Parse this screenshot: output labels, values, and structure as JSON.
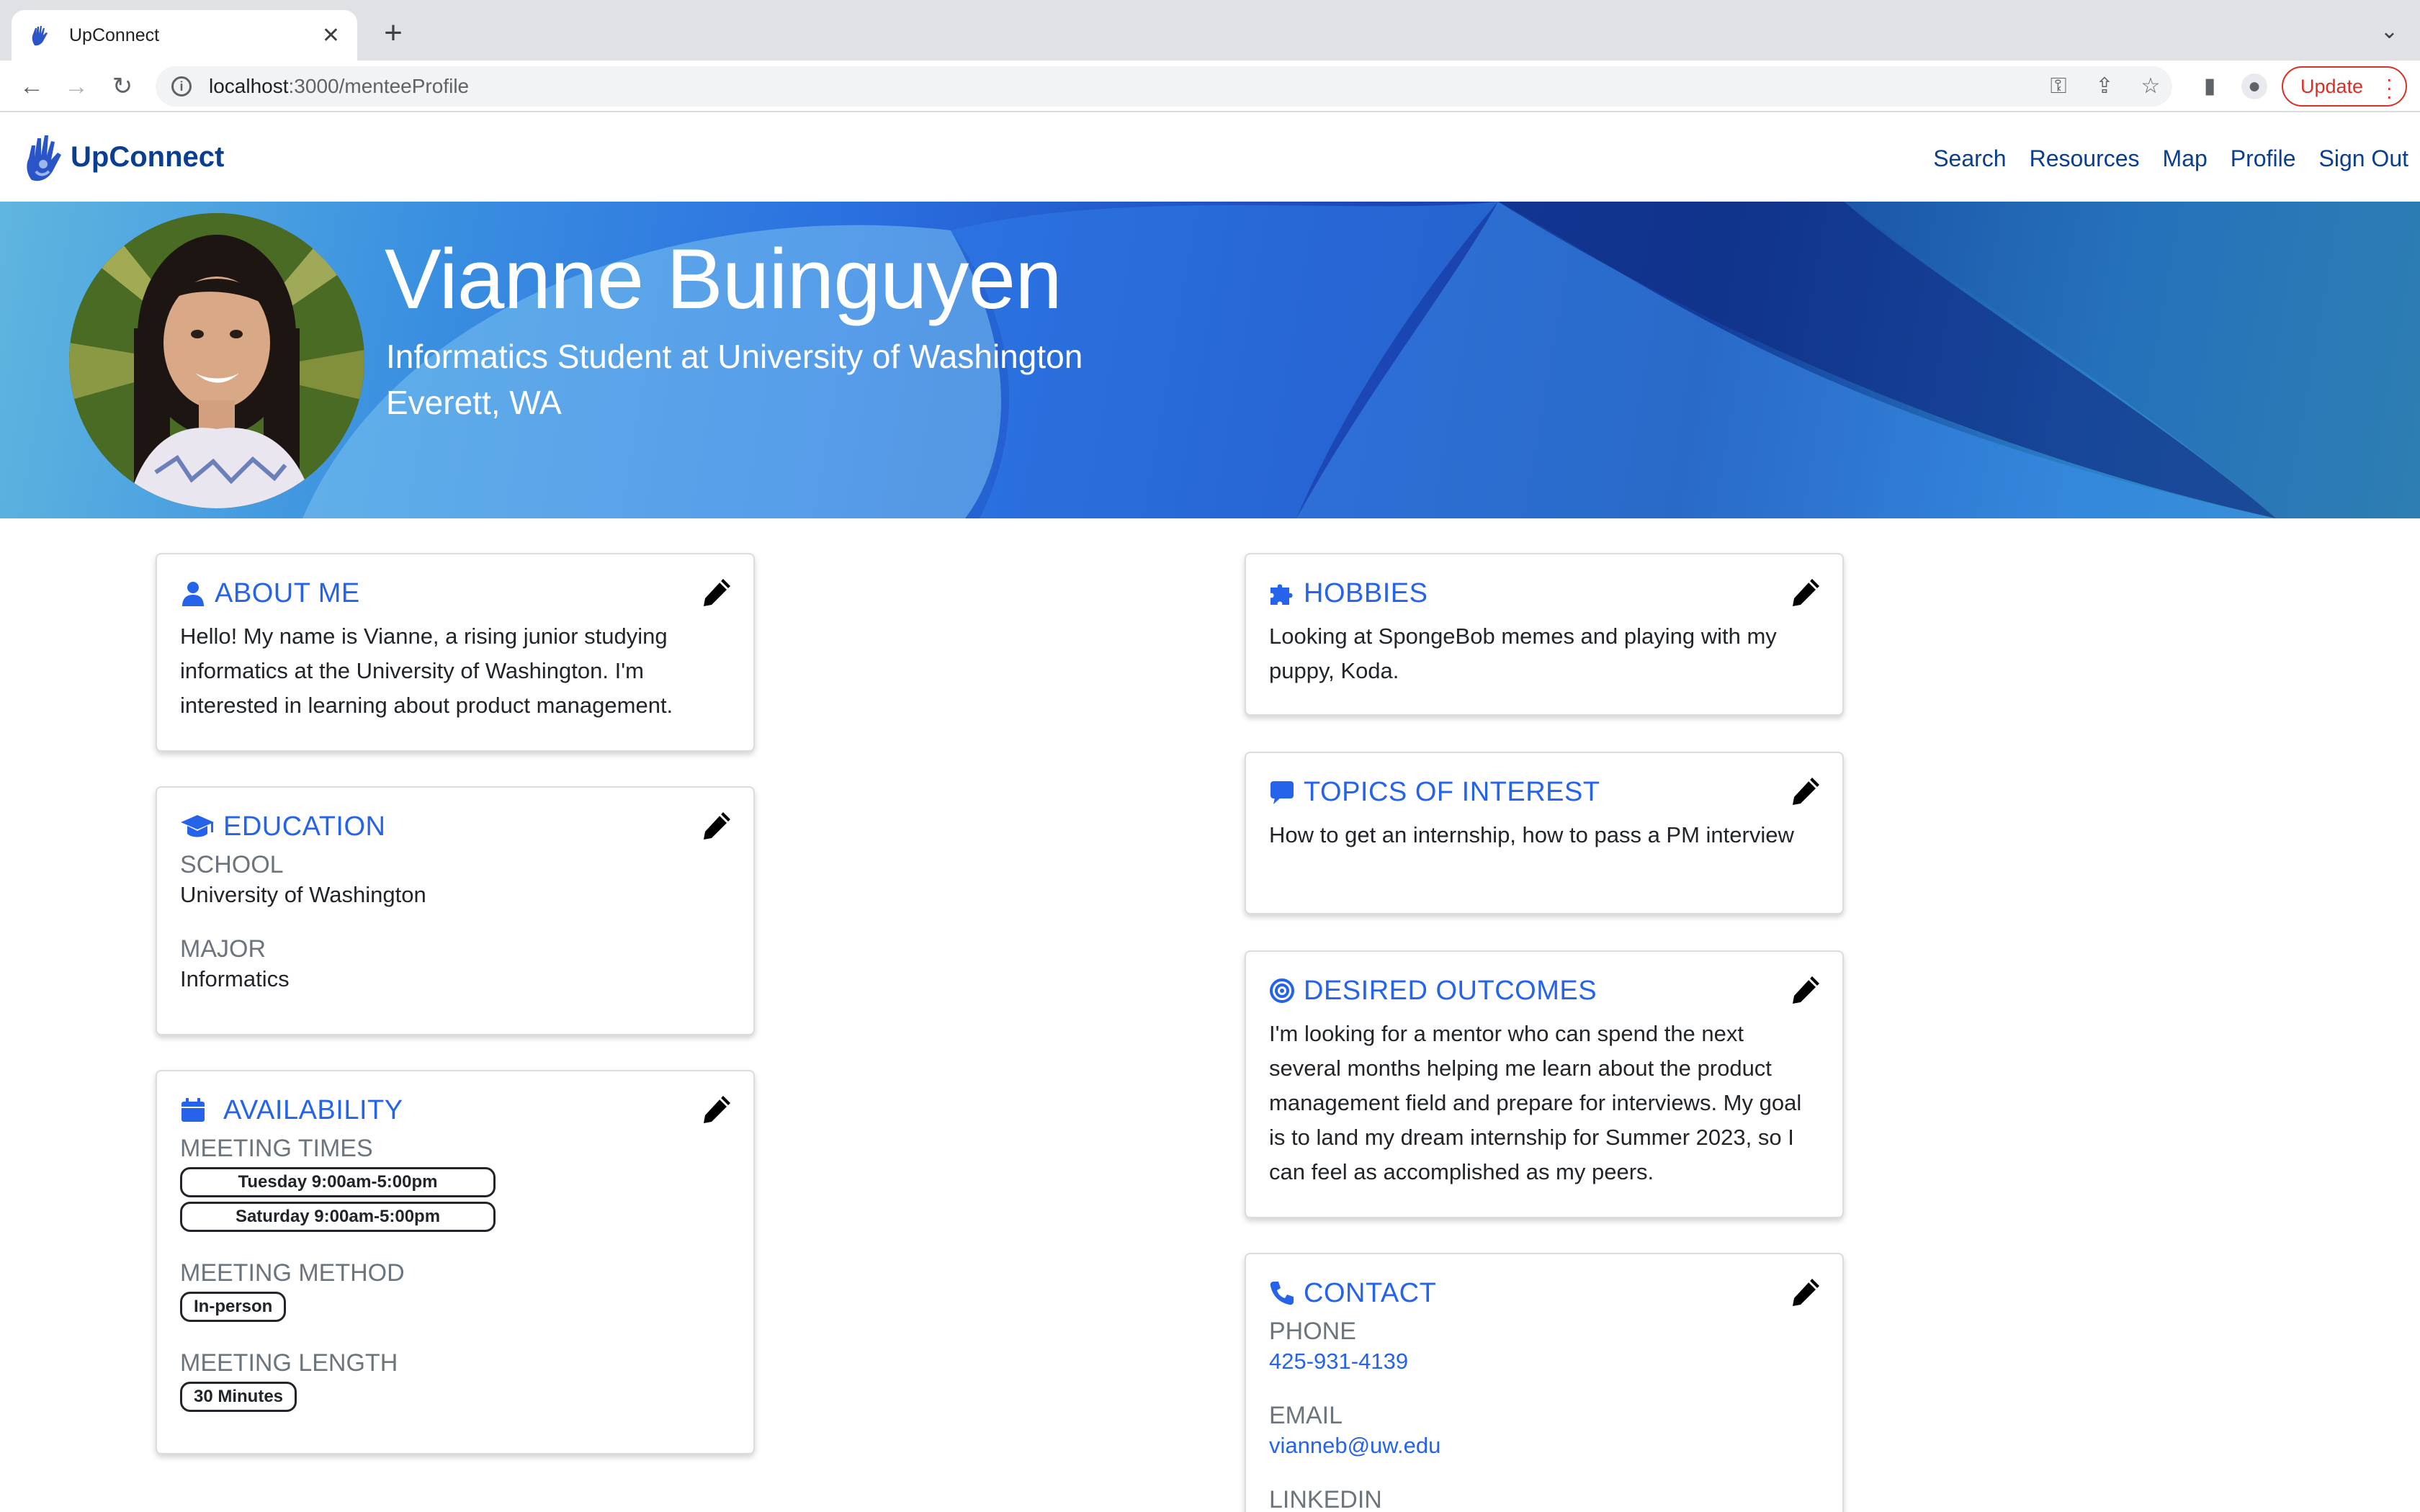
{
  "browser": {
    "tab_title": "UpConnect",
    "url_host": "localhost",
    "url_path": ":3000/menteeProfile",
    "update_label": "Update"
  },
  "navbar": {
    "brand": "UpConnect",
    "links": [
      "Search",
      "Resources",
      "Map",
      "Profile",
      "Sign Out"
    ]
  },
  "profile": {
    "name": "Vianne Buinguyen",
    "headline": "Informatics Student at University of Washington",
    "location": "Everett, WA"
  },
  "about": {
    "title": "ABOUT ME",
    "text": "Hello! My name is Vianne, a rising junior studying informatics at the University of Washington. I'm interested in learning about product management."
  },
  "education": {
    "title": "EDUCATION",
    "school_label": "SCHOOL",
    "school": "University of Washington",
    "major_label": "MAJOR",
    "major": "Informatics"
  },
  "availability": {
    "title": "AVAILABILITY",
    "times_label": "MEETING TIMES",
    "times": [
      "Tuesday 9:00am-5:00pm",
      "Saturday 9:00am-5:00pm"
    ],
    "method_label": "MEETING METHOD",
    "method": "In-person",
    "length_label": "MEETING LENGTH",
    "length": "30 Minutes"
  },
  "hobbies": {
    "title": "HOBBIES",
    "text": "Looking at SpongeBob memes and playing with my puppy, Koda."
  },
  "topics": {
    "title": "TOPICS OF INTEREST",
    "text": "How to get an internship, how to pass a PM interview"
  },
  "outcomes": {
    "title": "DESIRED OUTCOMES",
    "text": "I'm looking for a mentor who can spend the next several months helping me learn about the product management field and prepare for interviews. My goal is to land my dream internship for Summer 2023, so I can feel as accomplished as my peers."
  },
  "contact": {
    "title": "CONTACT",
    "phone_label": "PHONE",
    "phone": "425-931-4139",
    "email_label": "EMAIL",
    "email": "vianneb@uw.edu",
    "linkedin_label": "LINKEDIN"
  },
  "colors": {
    "accent": "#2563eb",
    "brand": "#0b3d91"
  }
}
